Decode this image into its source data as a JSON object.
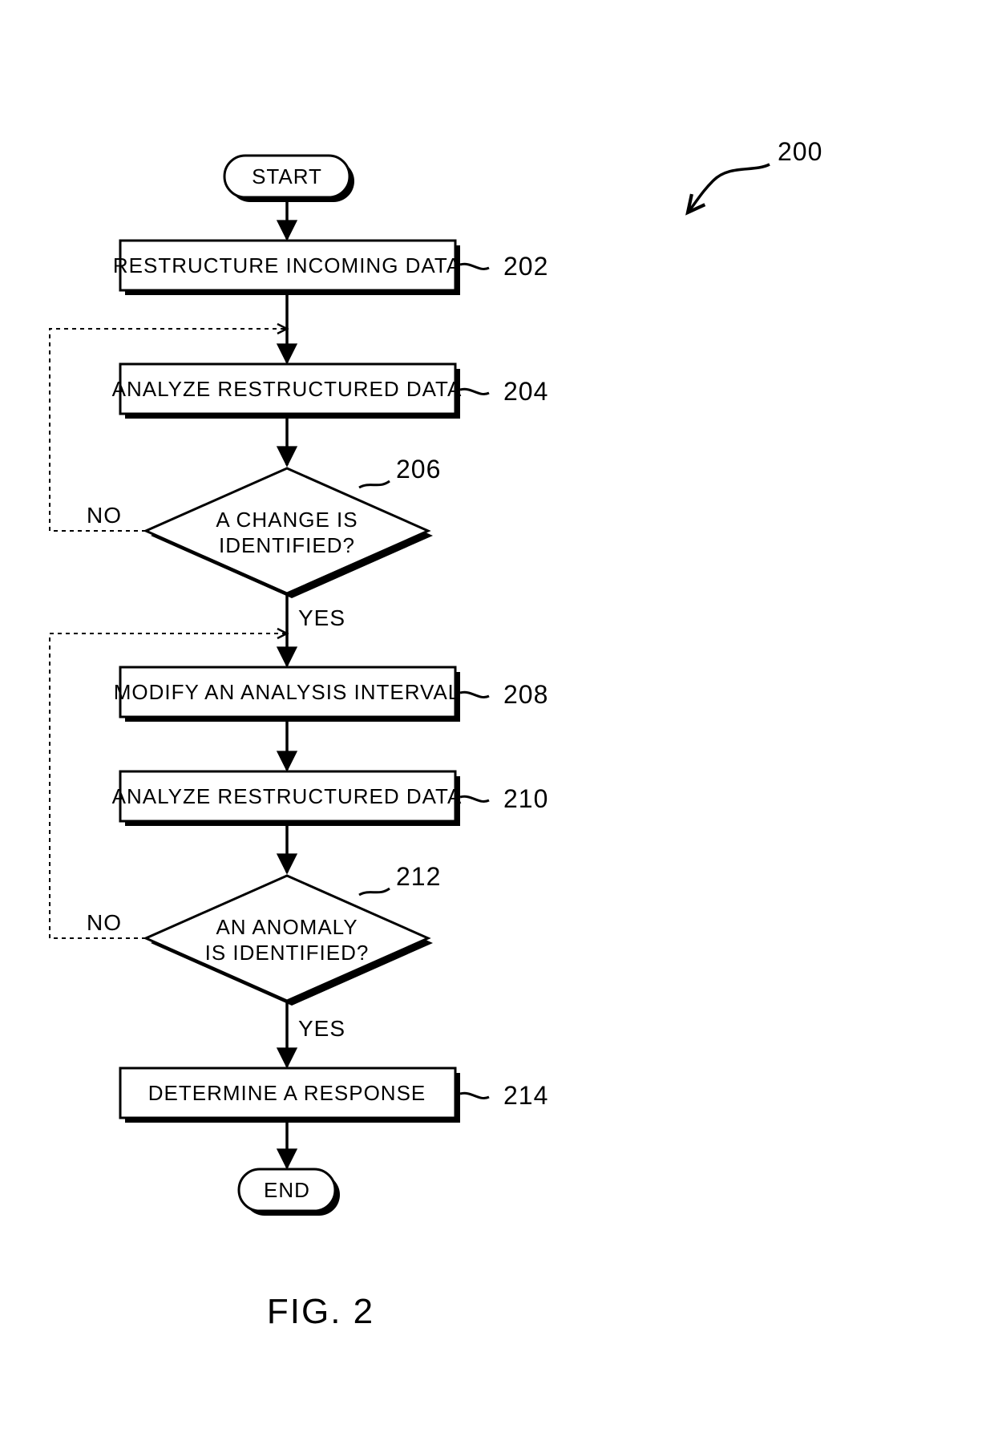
{
  "figure": {
    "number": "200",
    "caption": "FIG. 2"
  },
  "nodes": {
    "start": "START",
    "end": "END",
    "b202": "RESTRUCTURE INCOMING DATA",
    "b204": "ANALYZE RESTRUCTURED DATA",
    "d206_l1": "A CHANGE IS",
    "d206_l2": "IDENTIFIED?",
    "b208": "MODIFY AN ANALYSIS INTERVAL",
    "b210": "ANALYZE RESTRUCTURED DATA",
    "d212_l1": "AN ANOMALY",
    "d212_l2": "IS IDENTIFIED?",
    "b214": "DETERMINE A RESPONSE"
  },
  "refs": {
    "b202": "202",
    "b204": "204",
    "d206": "206",
    "b208": "208",
    "b210": "210",
    "d212": "212",
    "b214": "214"
  },
  "edges": {
    "no": "NO",
    "yes": "YES"
  }
}
